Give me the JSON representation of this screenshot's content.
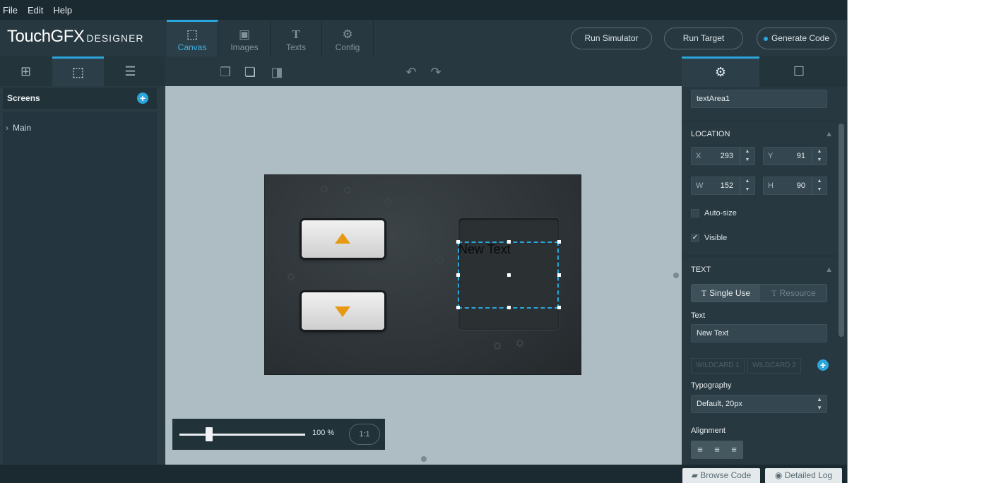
{
  "menu": [
    "File",
    "Edit",
    "Help"
  ],
  "logo": {
    "main": "TouchGFX",
    "sub": "DESIGNER"
  },
  "nav_tabs": [
    {
      "label": "Canvas",
      "icon": "canvas-icon"
    },
    {
      "label": "Images",
      "icon": "image-icon"
    },
    {
      "label": "Texts",
      "icon": "text-icon"
    },
    {
      "label": "Config",
      "icon": "gear-icon"
    }
  ],
  "buttons": {
    "run_simulator": "Run Simulator",
    "run_target": "Run Target",
    "generate_code": "Generate Code"
  },
  "left": {
    "screens_title": "Screens",
    "screen_item": "Main"
  },
  "canvas": {
    "new_text": "New Text",
    "zoom": "100 %",
    "one_to_one": "1:1"
  },
  "props": {
    "name": "textArea1",
    "location_label": "LOCATION",
    "x_label": "X",
    "x": "293",
    "y_label": "Y",
    "y": "91",
    "w_label": "W",
    "w": "152",
    "h_label": "H",
    "h": "90",
    "autosize_label": "Auto-size",
    "visible_label": "Visible",
    "text_section": "TEXT",
    "single_use": "Single Use",
    "resource": "Resource",
    "text_label": "Text",
    "text_value": "New Text",
    "wildcard1": "WILDCARD 1",
    "wildcard2": "WILDCARD 2",
    "typography_label": "Typography",
    "typography_value": "Default, 20px",
    "alignment_label": "Alignment"
  },
  "bottom": {
    "browse_code": "Browse Code",
    "detailed_log": "Detailed Log"
  },
  "colors": {
    "accent": "#2aa6dc",
    "arrow": "#e79a11",
    "canvas_bg": "#aebdc3"
  }
}
